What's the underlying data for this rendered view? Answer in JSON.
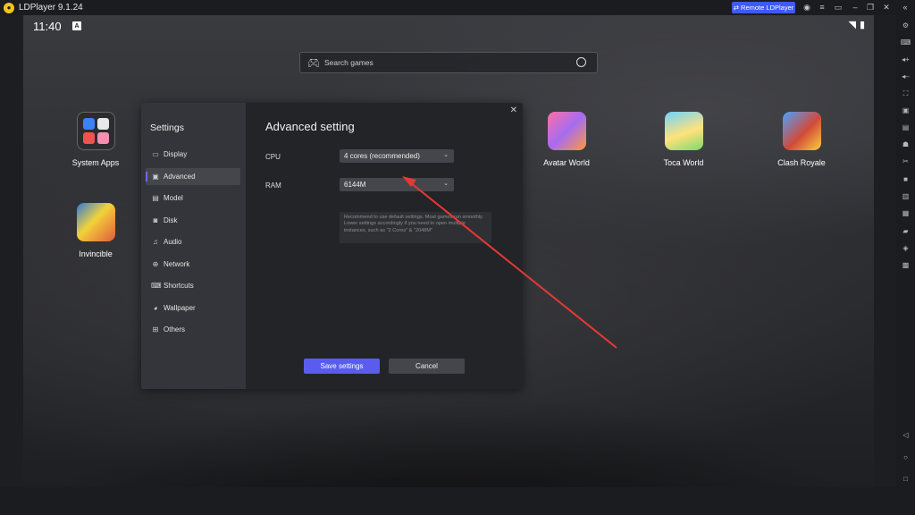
{
  "titlebar": {
    "title": "LDPlayer 9.1.24",
    "remote_label": "Remote LDPlayer"
  },
  "status": {
    "time": "11:40",
    "a_badge": "A"
  },
  "search": {
    "placeholder": "Search games"
  },
  "apps": [
    {
      "label": "System Apps",
      "icon": "system-apps-folder-icon"
    },
    {
      "label": "Avatar World",
      "icon": "avatar-world-icon"
    },
    {
      "label": "Toca World",
      "icon": "toca-world-icon"
    },
    {
      "label": "Clash Royale",
      "icon": "clash-royale-icon"
    },
    {
      "label": "Invincible",
      "icon": "invincible-icon"
    }
  ],
  "settings": {
    "title": "Settings",
    "nav": [
      {
        "label": "Display",
        "icon": "monitor-icon",
        "glyph": "▭"
      },
      {
        "label": "Advanced",
        "icon": "advanced-icon",
        "glyph": "▣",
        "active": true
      },
      {
        "label": "Model",
        "icon": "model-icon",
        "glyph": "▤"
      },
      {
        "label": "Disk",
        "icon": "disk-icon",
        "glyph": "◙"
      },
      {
        "label": "Audio",
        "icon": "audio-icon",
        "glyph": "♫"
      },
      {
        "label": "Network",
        "icon": "globe-icon",
        "glyph": "⊕"
      },
      {
        "label": "Shortcuts",
        "icon": "keyboard-icon",
        "glyph": "⌨"
      },
      {
        "label": "Wallpaper",
        "icon": "palette-icon",
        "glyph": "◕"
      },
      {
        "label": "Others",
        "icon": "grid-icon",
        "glyph": "⊞"
      }
    ],
    "section_title": "Advanced setting",
    "cpu_label": "CPU",
    "cpu_value": "4 cores (recommended)",
    "ram_label": "RAM",
    "ram_value": "6144M",
    "hint": "Recommend to use default settings. Most games run smoothly. Lower settings accordingly if you need to open multiple instances, such as \"2 Cores\" & \"2048M\"",
    "save_label": "Save settings",
    "cancel_label": "Cancel"
  },
  "colors": {
    "accent": "#5a5cf0",
    "remote": "#3d5afe",
    "annotation_arrow": "#e53935"
  }
}
